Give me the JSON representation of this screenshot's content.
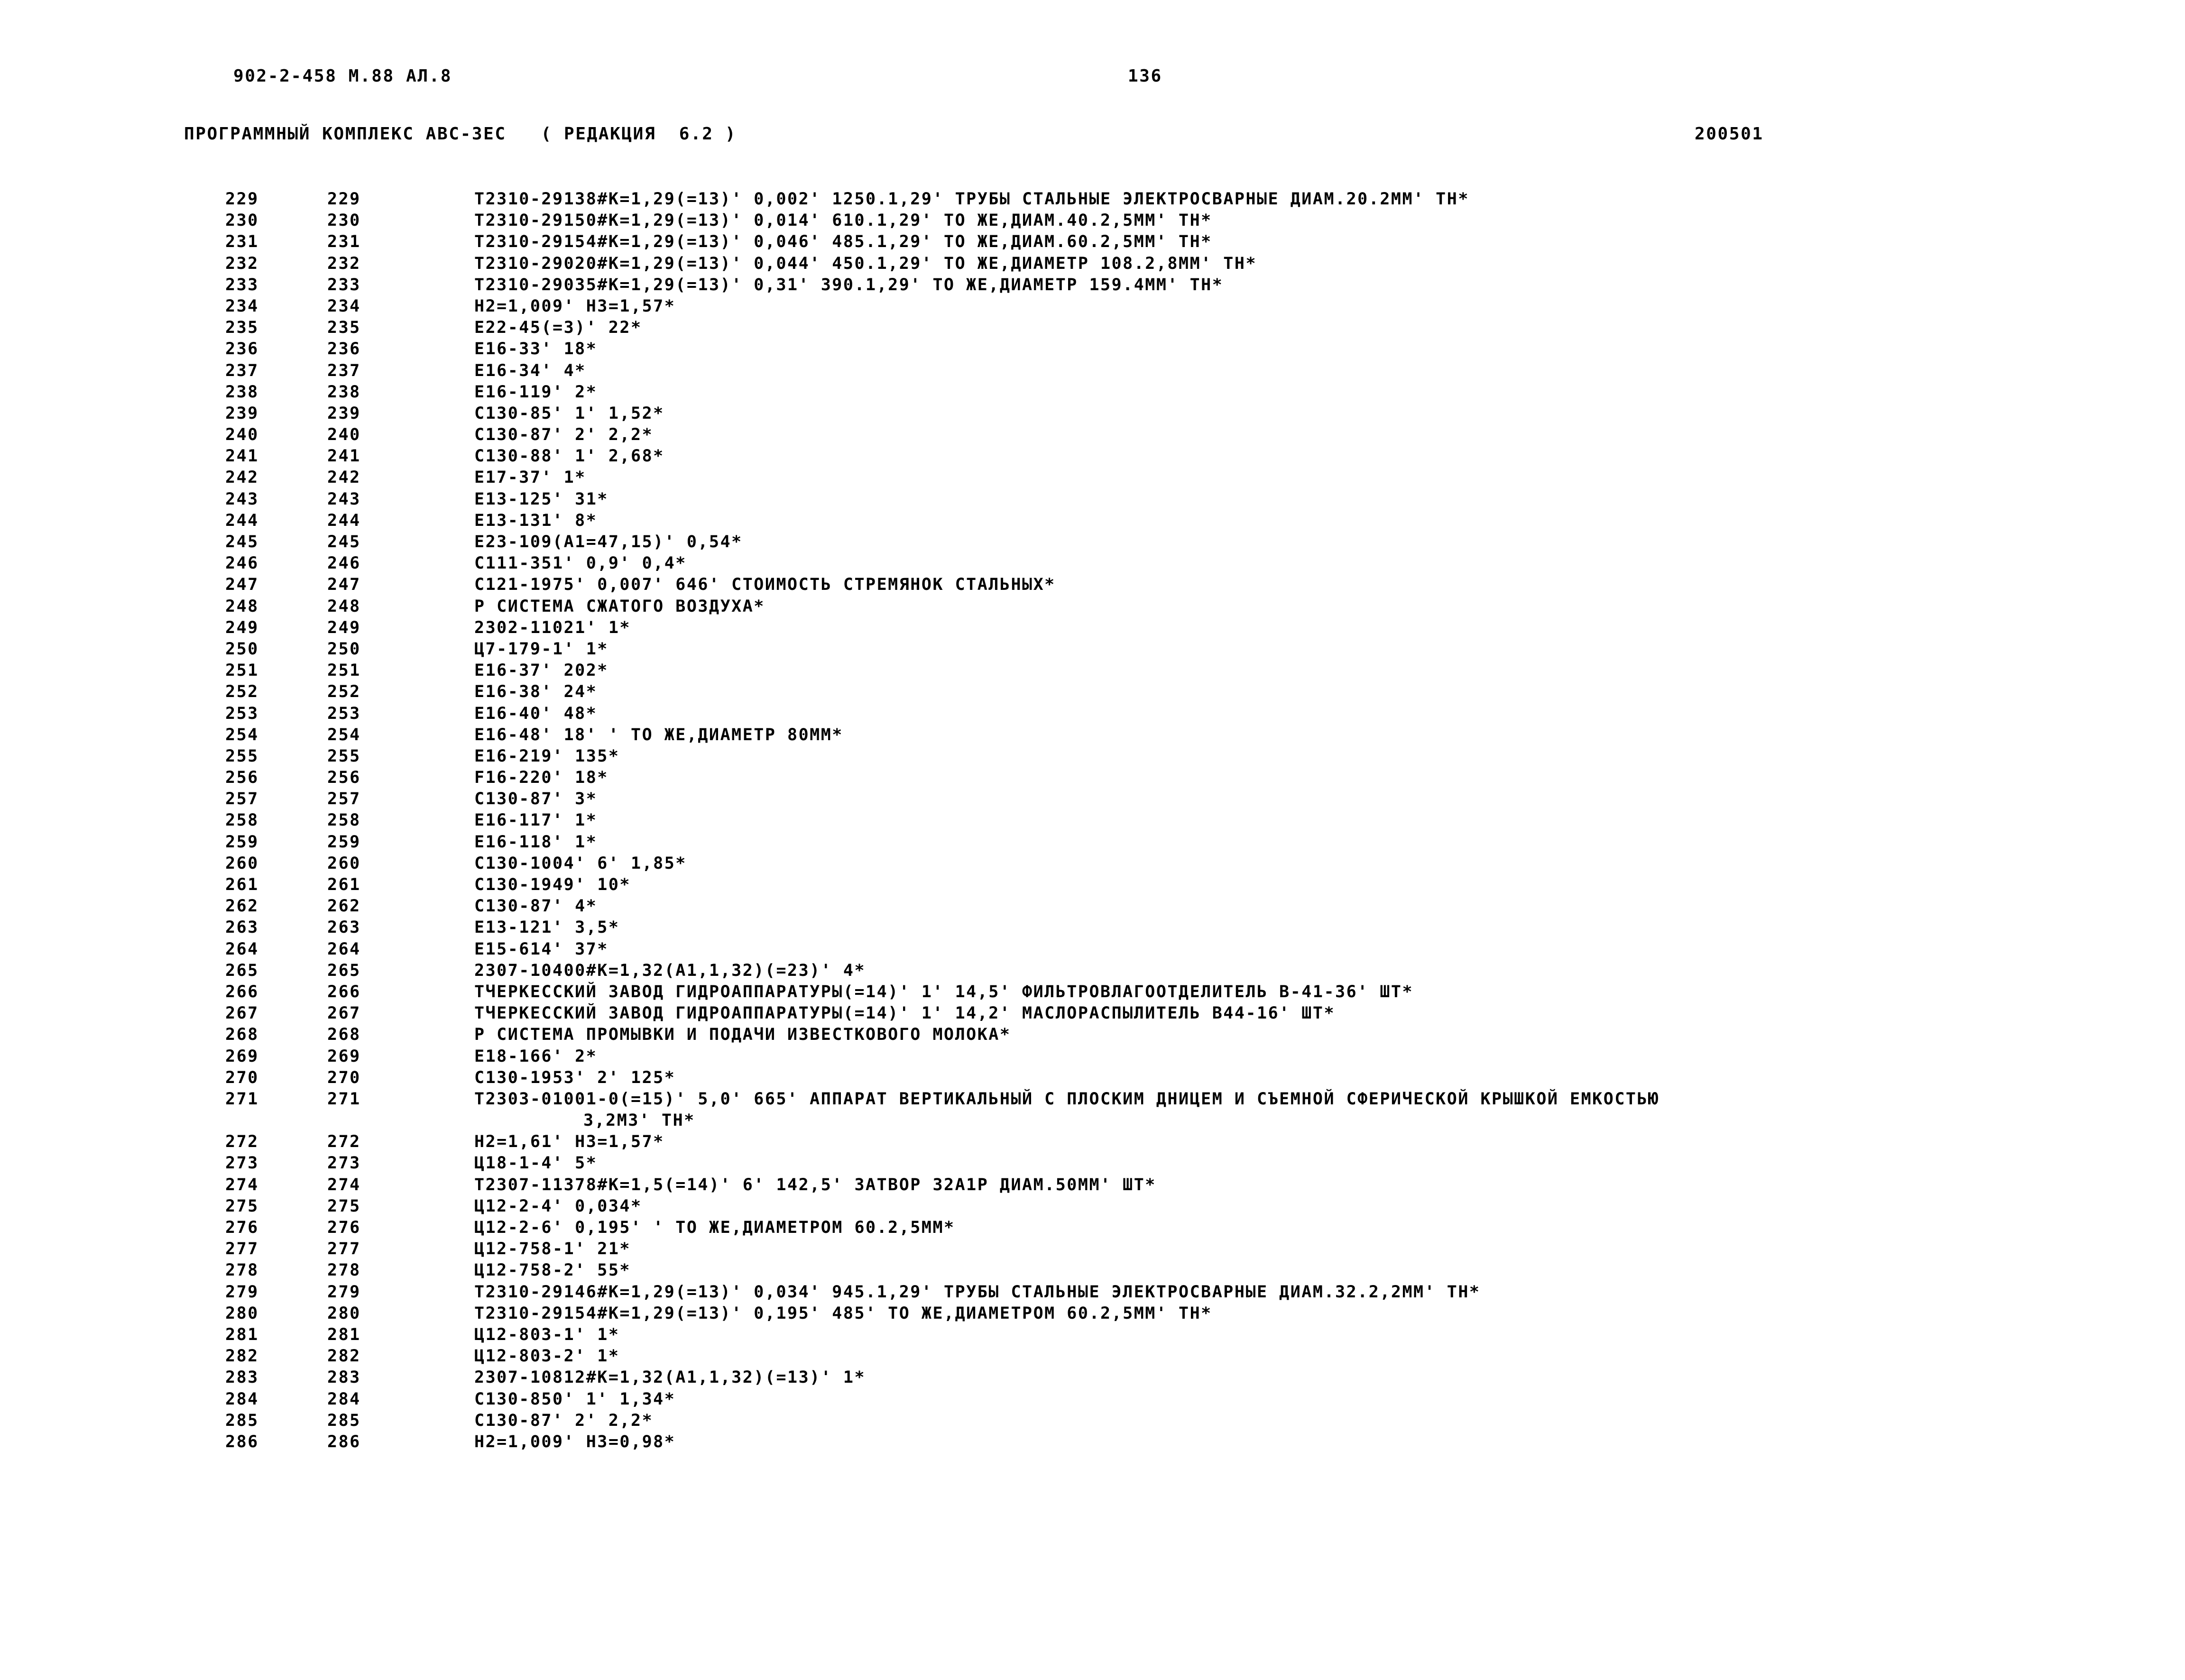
{
  "header": {
    "doc_code": "902-2-458 М.88 АЛ.8",
    "page_number": "136",
    "complex_title": "ПРОГРАММНЫЙ КОМПЛЕКС АВС-ЗЕС   ( РЕДАКЦИЯ  6.2 )",
    "revision_date": "200501"
  },
  "listing": {
    "rows": [
      {
        "seq": "229",
        "line": "229",
        "text": "Т2310-29138#К=1,29(=13)' 0,002' 1250.1,29' ТРУБЫ СТАЛЬНЫЕ ЭЛЕКТРОСВАРНЫЕ ДИАМ.20.2ММ' ТН*"
      },
      {
        "seq": "230",
        "line": "230",
        "text": "Т2310-29150#К=1,29(=13)' 0,014' 610.1,29' ТО ЖЕ,ДИАМ.40.2,5ММ' ТН*"
      },
      {
        "seq": "231",
        "line": "231",
        "text": "Т2310-29154#К=1,29(=13)' 0,046' 485.1,29' ТО ЖЕ,ДИАМ.60.2,5ММ' ТН*"
      },
      {
        "seq": "232",
        "line": "232",
        "text": "Т2310-29020#К=1,29(=13)' 0,044' 450.1,29' ТО ЖЕ,ДИАМЕТР 108.2,8ММ' ТН*"
      },
      {
        "seq": "233",
        "line": "233",
        "text": "Т2310-29035#К=1,29(=13)' 0,31' 390.1,29' ТО ЖЕ,ДИАМЕТР 159.4ММ' ТН*"
      },
      {
        "seq": "234",
        "line": "234",
        "text": "Н2=1,009' Н3=1,57*"
      },
      {
        "seq": "235",
        "line": "235",
        "text": "Е22-45(=3)' 22*"
      },
      {
        "seq": "236",
        "line": "236",
        "text": "Е16-33' 18*"
      },
      {
        "seq": "237",
        "line": "237",
        "text": "Е16-34' 4*"
      },
      {
        "seq": "238",
        "line": "238",
        "text": "Е16-119' 2*"
      },
      {
        "seq": "239",
        "line": "239",
        "text": "С130-85' 1' 1,52*"
      },
      {
        "seq": "240",
        "line": "240",
        "text": "С130-87' 2' 2,2*"
      },
      {
        "seq": "241",
        "line": "241",
        "text": "С130-88' 1' 2,68*"
      },
      {
        "seq": "242",
        "line": "242",
        "text": "Е17-37' 1*"
      },
      {
        "seq": "243",
        "line": "243",
        "text": "Е13-125' 31*"
      },
      {
        "seq": "244",
        "line": "244",
        "text": "Е13-131' 8*"
      },
      {
        "seq": "245",
        "line": "245",
        "text": "Е23-109(А1=47,15)' 0,54*"
      },
      {
        "seq": "246",
        "line": "246",
        "text": "С111-351' 0,9' 0,4*"
      },
      {
        "seq": "247",
        "line": "247",
        "text": "С121-1975' 0,007' 646' СТОИМОСТЬ СТРЕМЯНОК СТАЛЬНЫХ*"
      },
      {
        "seq": "248",
        "line": "248",
        "text": "Р СИСТЕМА СЖАТОГО ВОЗДУХА*"
      },
      {
        "seq": "249",
        "line": "249",
        "text": "2302-11021' 1*"
      },
      {
        "seq": "250",
        "line": "250",
        "text": "Ц7-179-1' 1*"
      },
      {
        "seq": "251",
        "line": "251",
        "text": "Е16-37' 202*"
      },
      {
        "seq": "252",
        "line": "252",
        "text": "Е16-38' 24*"
      },
      {
        "seq": "253",
        "line": "253",
        "text": "Е16-40' 48*"
      },
      {
        "seq": "254",
        "line": "254",
        "text": "Е16-48' 18' ' ТО ЖЕ,ДИАМЕТР 80ММ*"
      },
      {
        "seq": "255",
        "line": "255",
        "text": "Е16-219' 135*"
      },
      {
        "seq": "256",
        "line": "256",
        "text": "F16-220' 18*"
      },
      {
        "seq": "257",
        "line": "257",
        "text": "С130-87' 3*"
      },
      {
        "seq": "258",
        "line": "258",
        "text": "Е16-117' 1*"
      },
      {
        "seq": "259",
        "line": "259",
        "text": "Е16-118' 1*"
      },
      {
        "seq": "260",
        "line": "260",
        "text": "С130-1004' 6' 1,85*"
      },
      {
        "seq": "261",
        "line": "261",
        "text": "С130-1949' 10*"
      },
      {
        "seq": "262",
        "line": "262",
        "text": "С130-87' 4*"
      },
      {
        "seq": "263",
        "line": "263",
        "text": "Е13-121' 3,5*"
      },
      {
        "seq": "264",
        "line": "264",
        "text": "Е15-614' 37*"
      },
      {
        "seq": "265",
        "line": "265",
        "text": "2307-10400#К=1,32(А1,1,32)(=23)' 4*"
      },
      {
        "seq": "266",
        "line": "266",
        "text": "ТЧЕРКЕССКИЙ ЗАВОД ГИДРОАППАРАТУРЫ(=14)' 1' 14,5' ФИЛЬТРОВЛАГООТДЕЛИТЕЛЬ В-41-36' ШТ*"
      },
      {
        "seq": "267",
        "line": "267",
        "text": "ТЧЕРКЕССКИЙ ЗАВОД ГИДРОАППАРАТУРЫ(=14)' 1' 14,2' МАСЛОРАСПЫЛИТЕЛЬ В44-16' ШТ*"
      },
      {
        "seq": "268",
        "line": "268",
        "text": "Р СИСТЕМА ПРОМЫВКИ И ПОДАЧИ ИЗВЕСТКОВОГО МОЛОКА*"
      },
      {
        "seq": "269",
        "line": "269",
        "text": "Е18-166' 2*"
      },
      {
        "seq": "270",
        "line": "270",
        "text": "С130-1953' 2' 125*"
      },
      {
        "seq": "271",
        "line": "271",
        "text": "Т2303-01001-0(=15)' 5,0' 665' АППАРАТ ВЕРТИКАЛЬНЫЙ С ПЛОСКИМ ДНИЦЕМ И СЪЕМНОЙ СФЕРИЧЕСКОЙ КРЫШКОЙ ЕМКОСТЬЮ"
      },
      {
        "seq": "",
        "line": "",
        "text": "3,2М3' ТН*",
        "continuation": true
      },
      {
        "seq": "272",
        "line": "272",
        "text": "Н2=1,61' Н3=1,57*"
      },
      {
        "seq": "273",
        "line": "273",
        "text": "Ц18-1-4' 5*"
      },
      {
        "seq": "274",
        "line": "274",
        "text": "Т2307-11378#К=1,5(=14)' 6' 142,5' ЗАТВОР 32А1Р ДИАМ.50ММ' ШТ*"
      },
      {
        "seq": "275",
        "line": "275",
        "text": "Ц12-2-4' 0,034*"
      },
      {
        "seq": "276",
        "line": "276",
        "text": "Ц12-2-6' 0,195' ' ТО ЖЕ,ДИАМЕТРОМ 60.2,5ММ*"
      },
      {
        "seq": "277",
        "line": "277",
        "text": "Ц12-758-1' 21*"
      },
      {
        "seq": "278",
        "line": "278",
        "text": "Ц12-758-2' 55*"
      },
      {
        "seq": "279",
        "line": "279",
        "text": "Т2310-29146#К=1,29(=13)' 0,034' 945.1,29' ТРУБЫ СТАЛЬНЫЕ ЭЛЕКТРОСВАРНЫЕ ДИАМ.32.2,2ММ' ТН*"
      },
      {
        "seq": "280",
        "line": "280",
        "text": "Т2310-29154#К=1,29(=13)' 0,195' 485' ТО ЖЕ,ДИАМЕТРОМ 60.2,5ММ' ТН*"
      },
      {
        "seq": "281",
        "line": "281",
        "text": "Ц12-803-1' 1*"
      },
      {
        "seq": "282",
        "line": "282",
        "text": "Ц12-803-2' 1*"
      },
      {
        "seq": "283",
        "line": "283",
        "text": "2307-10812#К=1,32(А1,1,32)(=13)' 1*"
      },
      {
        "seq": "284",
        "line": "284",
        "text": "С130-850' 1' 1,34*"
      },
      {
        "seq": "285",
        "line": "285",
        "text": "С130-87' 2' 2,2*"
      },
      {
        "seq": "286",
        "line": "286",
        "text": "Н2=1,009' Н3=0,98*"
      }
    ]
  }
}
